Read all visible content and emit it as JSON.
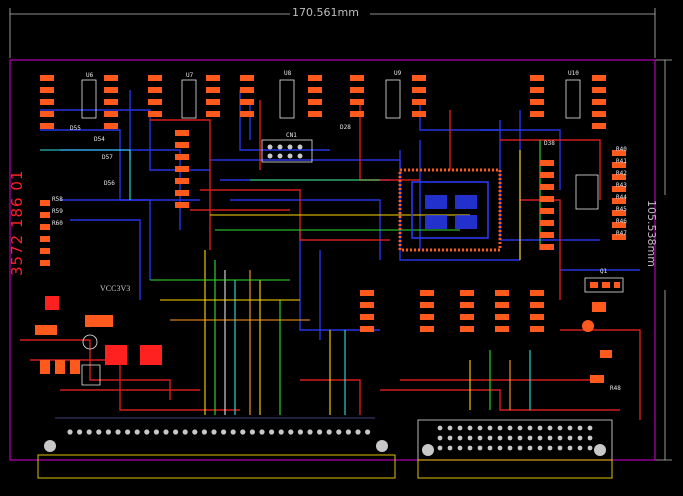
{
  "pcb": {
    "board_width_label": "170.561mm",
    "board_height_label": "105.538mm",
    "board_id": "3572 186 01",
    "net_label": "VCC3V3",
    "silkscreen": {
      "u6": "U6",
      "u7": "U7",
      "u8": "U8",
      "u9": "U9",
      "u10": "U10",
      "d55": "D55",
      "d54": "D54",
      "d57": "D57",
      "d56": "D56",
      "d38": "D38",
      "d28": "D28",
      "r40": "R40",
      "r41": "R41",
      "r42": "R42",
      "r43": "R43",
      "r44": "R44",
      "r45": "R45",
      "r46": "R46",
      "r47": "R47",
      "r48": "R48",
      "r58": "R58",
      "r59": "R59",
      "r60": "R60",
      "q1": "Q1",
      "cn1": "CN1"
    },
    "colors": {
      "background": "#000000",
      "board_outline": "#b400b4",
      "top_copper": "#e02020",
      "bottom_copper": "#2a3cff",
      "pads": "#ff5a1e",
      "silkscreen": "#e8e8e8",
      "dimension": "#bdbdbd",
      "connector_outline": "#e0c000"
    }
  }
}
